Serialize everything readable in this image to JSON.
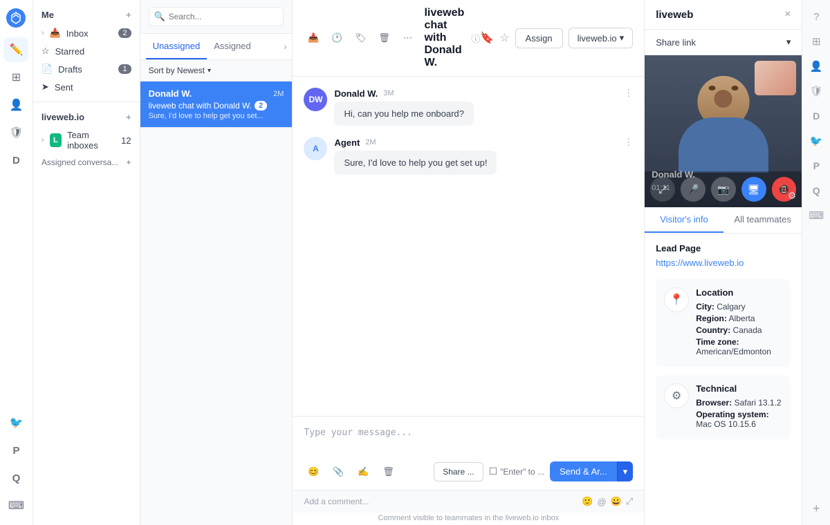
{
  "app": {
    "logo": "✦"
  },
  "sidebar": {
    "me_label": "Me",
    "inbox_label": "Inbox",
    "inbox_count": "2",
    "starred_label": "Starred",
    "drafts_label": "Drafts",
    "drafts_count": "1",
    "sent_label": "Sent",
    "liveweb_label": "liveweb.io",
    "team_inboxes_label": "Team inboxes",
    "team_inboxes_count": "12",
    "team_inbox_icon": "L",
    "assigned_convo_label": "Assigned conversa...",
    "add_icon": "+"
  },
  "conv_list": {
    "search_placeholder": "Search...",
    "tab_unassigned": "Unassigned",
    "tab_assigned": "Assigned",
    "sort_label": "Sort by Newest",
    "conversation": {
      "name": "Donald W.",
      "time": "2M",
      "subject": "liveweb chat with Donald W.",
      "badge": "2",
      "preview": "Sure, I'd love to help get you set..."
    }
  },
  "chat": {
    "header_title": "liveweb chat with Donald W.",
    "assign_label": "Assign",
    "inbox_label": "liveweb.io",
    "messages": [
      {
        "sender": "Donald W.",
        "initials": "DW",
        "time": "3M",
        "text": "Hi, can you help me onboard?",
        "is_agent": false
      },
      {
        "sender": "Agent",
        "initials": "A",
        "time": "2M",
        "text": "Sure, I'd love to help you get set up!",
        "is_agent": true
      }
    ],
    "input_placeholder": "Type your message...",
    "share_label": "Share ...",
    "enter_label": "\"Enter\" to ...",
    "send_label": "Send & Ar...",
    "comment_placeholder": "Add a comment...",
    "comment_note": "Comment visible to teammates in the liveweb.io inbox"
  },
  "right_panel": {
    "title": "liveweb",
    "share_link_label": "Share link",
    "visitor_name": "Donald W.",
    "call_timer": "01:11",
    "tabs": {
      "visitor_info": "Visitor's info",
      "all_teammates": "All teammates"
    },
    "lead_page_label": "Lead Page",
    "lead_page_url": "https://www.liveweb.io",
    "location_label": "Location",
    "city_label": "City:",
    "city_value": "Calgary",
    "region_label": "Region:",
    "region_value": "Alberta",
    "country_label": "Country:",
    "country_value": "Canada",
    "timezone_label": "Time zone:",
    "timezone_value": "American/Edmonton",
    "technical_label": "Technical",
    "browser_label": "Browser:",
    "browser_value": "Safari 13.1.2",
    "os_label": "Operating system:",
    "os_value": "Mac OS 10.15.6"
  },
  "icons": {
    "search": "🔍",
    "inbox": "📥",
    "star": "☆",
    "draft": "📄",
    "send": "➤",
    "chevron_right": "›",
    "chevron_down": "∨",
    "add": "+",
    "close": "×",
    "info": "ⓘ",
    "bookmark": "🔖",
    "star_outline": "☆",
    "trash": "🗑",
    "clock": "🕐",
    "label": "🏷",
    "more": "⋯",
    "emoji": "😊",
    "attachment": "📎",
    "signature": "✍",
    "share": "↗",
    "checkbox": "☐",
    "expand": "⤢",
    "mic": "🎤",
    "camera": "📷",
    "screen": "🖥",
    "end_call": "📵",
    "gear": "⚙",
    "location_pin": "📍",
    "question": "?",
    "grid": "⊞",
    "person": "👤",
    "shield": "🛡",
    "letter_d": "D",
    "bird": "🐦",
    "keyboard": "⌨",
    "plus": "+"
  }
}
